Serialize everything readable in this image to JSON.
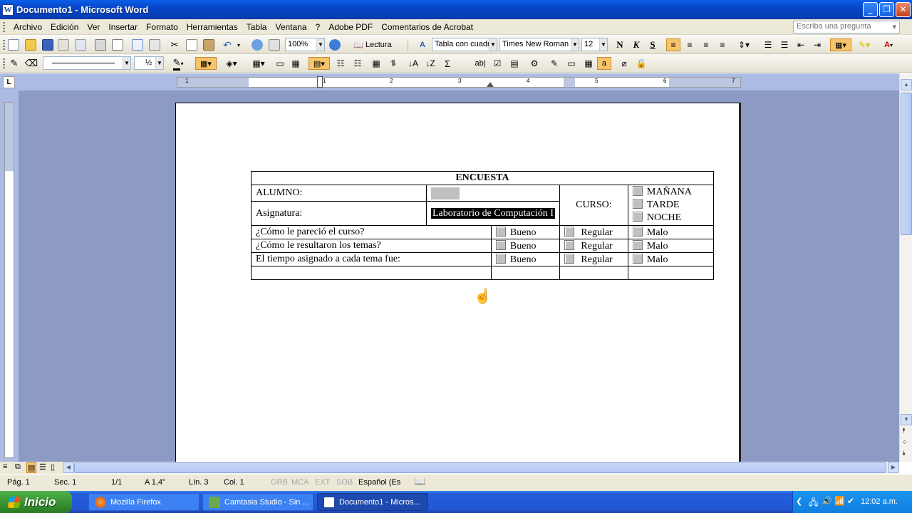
{
  "window": {
    "title": "Documento1 - Microsoft Word",
    "app_icon": "W",
    "minimize": "_",
    "maximize": "❐",
    "close": "✕"
  },
  "menu": [
    "Archivo",
    "Edición",
    "Ver",
    "Insertar",
    "Formato",
    "Herramientas",
    "Tabla",
    "Ventana",
    "?",
    "Adobe PDF",
    "Comentarios de Acrobat"
  ],
  "ask_box": {
    "placeholder": "Escriba una pregunta",
    "arrow": "▾"
  },
  "toolbar1": {
    "zoom": "100%",
    "reading": "Lectura",
    "style": "Tabla con cuadr",
    "font": "Times New Roman",
    "size": "12",
    "bold": "N",
    "italic": "K",
    "strike": "S"
  },
  "toolbar2": {
    "line_weight": "½"
  },
  "ruler": {
    "numbers": [
      "1",
      "1",
      "2",
      "3",
      "4",
      "5",
      "6",
      "7"
    ]
  },
  "table": {
    "title": "ENCUESTA",
    "alumno_label": "ALUMNO:",
    "asignatura_label": "Asignatura:",
    "asignatura_value": "Laboratorio de Computación I",
    "curso_label": "CURSO:",
    "turnos": [
      "MAÑANA",
      "TARDE",
      "NOCHE"
    ],
    "questions": [
      {
        "q": "¿Cómo le pareció el curso?",
        "a": "Bueno",
        "b": "Regular",
        "c": "Malo"
      },
      {
        "q": "¿Cómo le resultaron los temas?",
        "a": "Bueno",
        "b": "Regular",
        "c": "Malo"
      },
      {
        "q": "El tiempo asignado a cada tema fue:",
        "a": "Bueno",
        "b": "Regular",
        "c": "Malo"
      }
    ]
  },
  "status": {
    "page": "Pág. 1",
    "sec": "Sec. 1",
    "pages": "1/1",
    "at": "A 1,4\"",
    "line": "Lín. 3",
    "col": "Col. 1",
    "grb": "GRB",
    "mca": "MCA",
    "ext": "EXT",
    "sob": "SOB",
    "lang": "Español (Es"
  },
  "taskbar": {
    "start": "Inicio",
    "tasks": [
      {
        "label": "Mozilla Firefox"
      },
      {
        "label": "Camtasia Studio - Sin ..."
      },
      {
        "label": "Documento1 - Micros..."
      }
    ],
    "clock": "12:02 a.m."
  }
}
